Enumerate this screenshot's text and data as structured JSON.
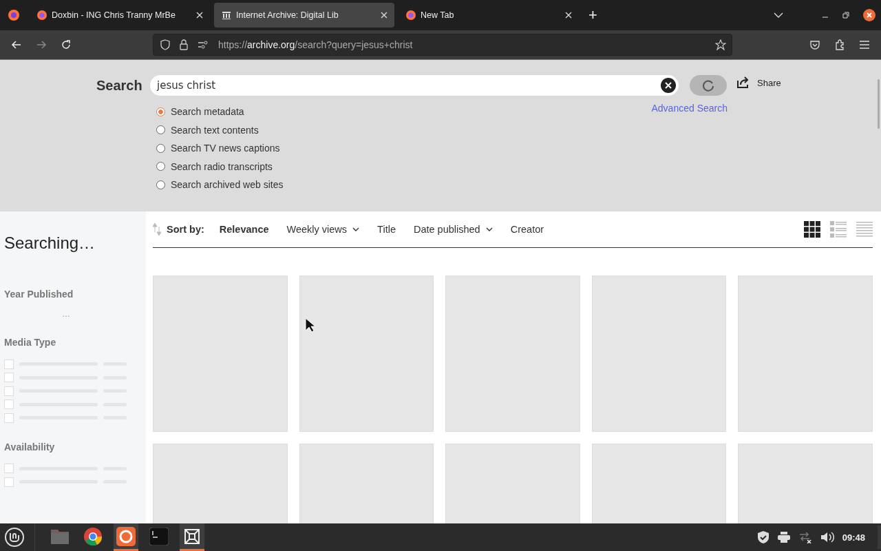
{
  "browser": {
    "tabs": [
      {
        "title": "Doxbin - ING Chris Tranny MrBe",
        "selected": false
      },
      {
        "title": "Internet Archive: Digital Lib",
        "selected": true
      },
      {
        "title": "New Tab",
        "selected": false
      }
    ],
    "new_tab": "+",
    "address": {
      "scheme": "https://",
      "domain": "archive.org",
      "path": "/search?query=jesus+christ"
    }
  },
  "search": {
    "label": "Search",
    "value": "jesus christ",
    "share": "Share",
    "advanced": "Advanced Search",
    "options": [
      {
        "label": "Search metadata",
        "selected": true
      },
      {
        "label": "Search text contents",
        "selected": false
      },
      {
        "label": "Search TV news captions",
        "selected": false
      },
      {
        "label": "Search radio transcripts",
        "selected": false
      },
      {
        "label": "Search archived web sites",
        "selected": false
      }
    ]
  },
  "sidebar": {
    "status": "Searching…",
    "facets": [
      {
        "title": "Year Published",
        "kind": "dots",
        "text": "…"
      },
      {
        "title": "Media Type",
        "kind": "list"
      },
      {
        "title": "Availability",
        "kind": "list"
      }
    ]
  },
  "sort": {
    "label": "Sort by:",
    "options": [
      {
        "label": "Relevance",
        "kind": "plain",
        "selected": true
      },
      {
        "label": "Weekly views",
        "kind": "dropdown",
        "selected": false
      },
      {
        "label": "Title",
        "kind": "plain",
        "selected": false
      },
      {
        "label": "Date published",
        "kind": "dropdown",
        "selected": false
      },
      {
        "label": "Creator",
        "kind": "plain",
        "selected": false
      }
    ],
    "views": [
      {
        "kind": "grid",
        "selected": true
      },
      {
        "kind": "list",
        "selected": false
      },
      {
        "kind": "compact",
        "selected": false
      }
    ]
  },
  "taskbar": {
    "apps": [
      {
        "kind": "files",
        "active": false
      },
      {
        "kind": "chrome",
        "active": false
      },
      {
        "kind": "firefox",
        "active": true
      },
      {
        "kind": "terminal",
        "active": false
      },
      {
        "kind": "xapp",
        "active": true
      }
    ],
    "clock": "09:48"
  }
}
